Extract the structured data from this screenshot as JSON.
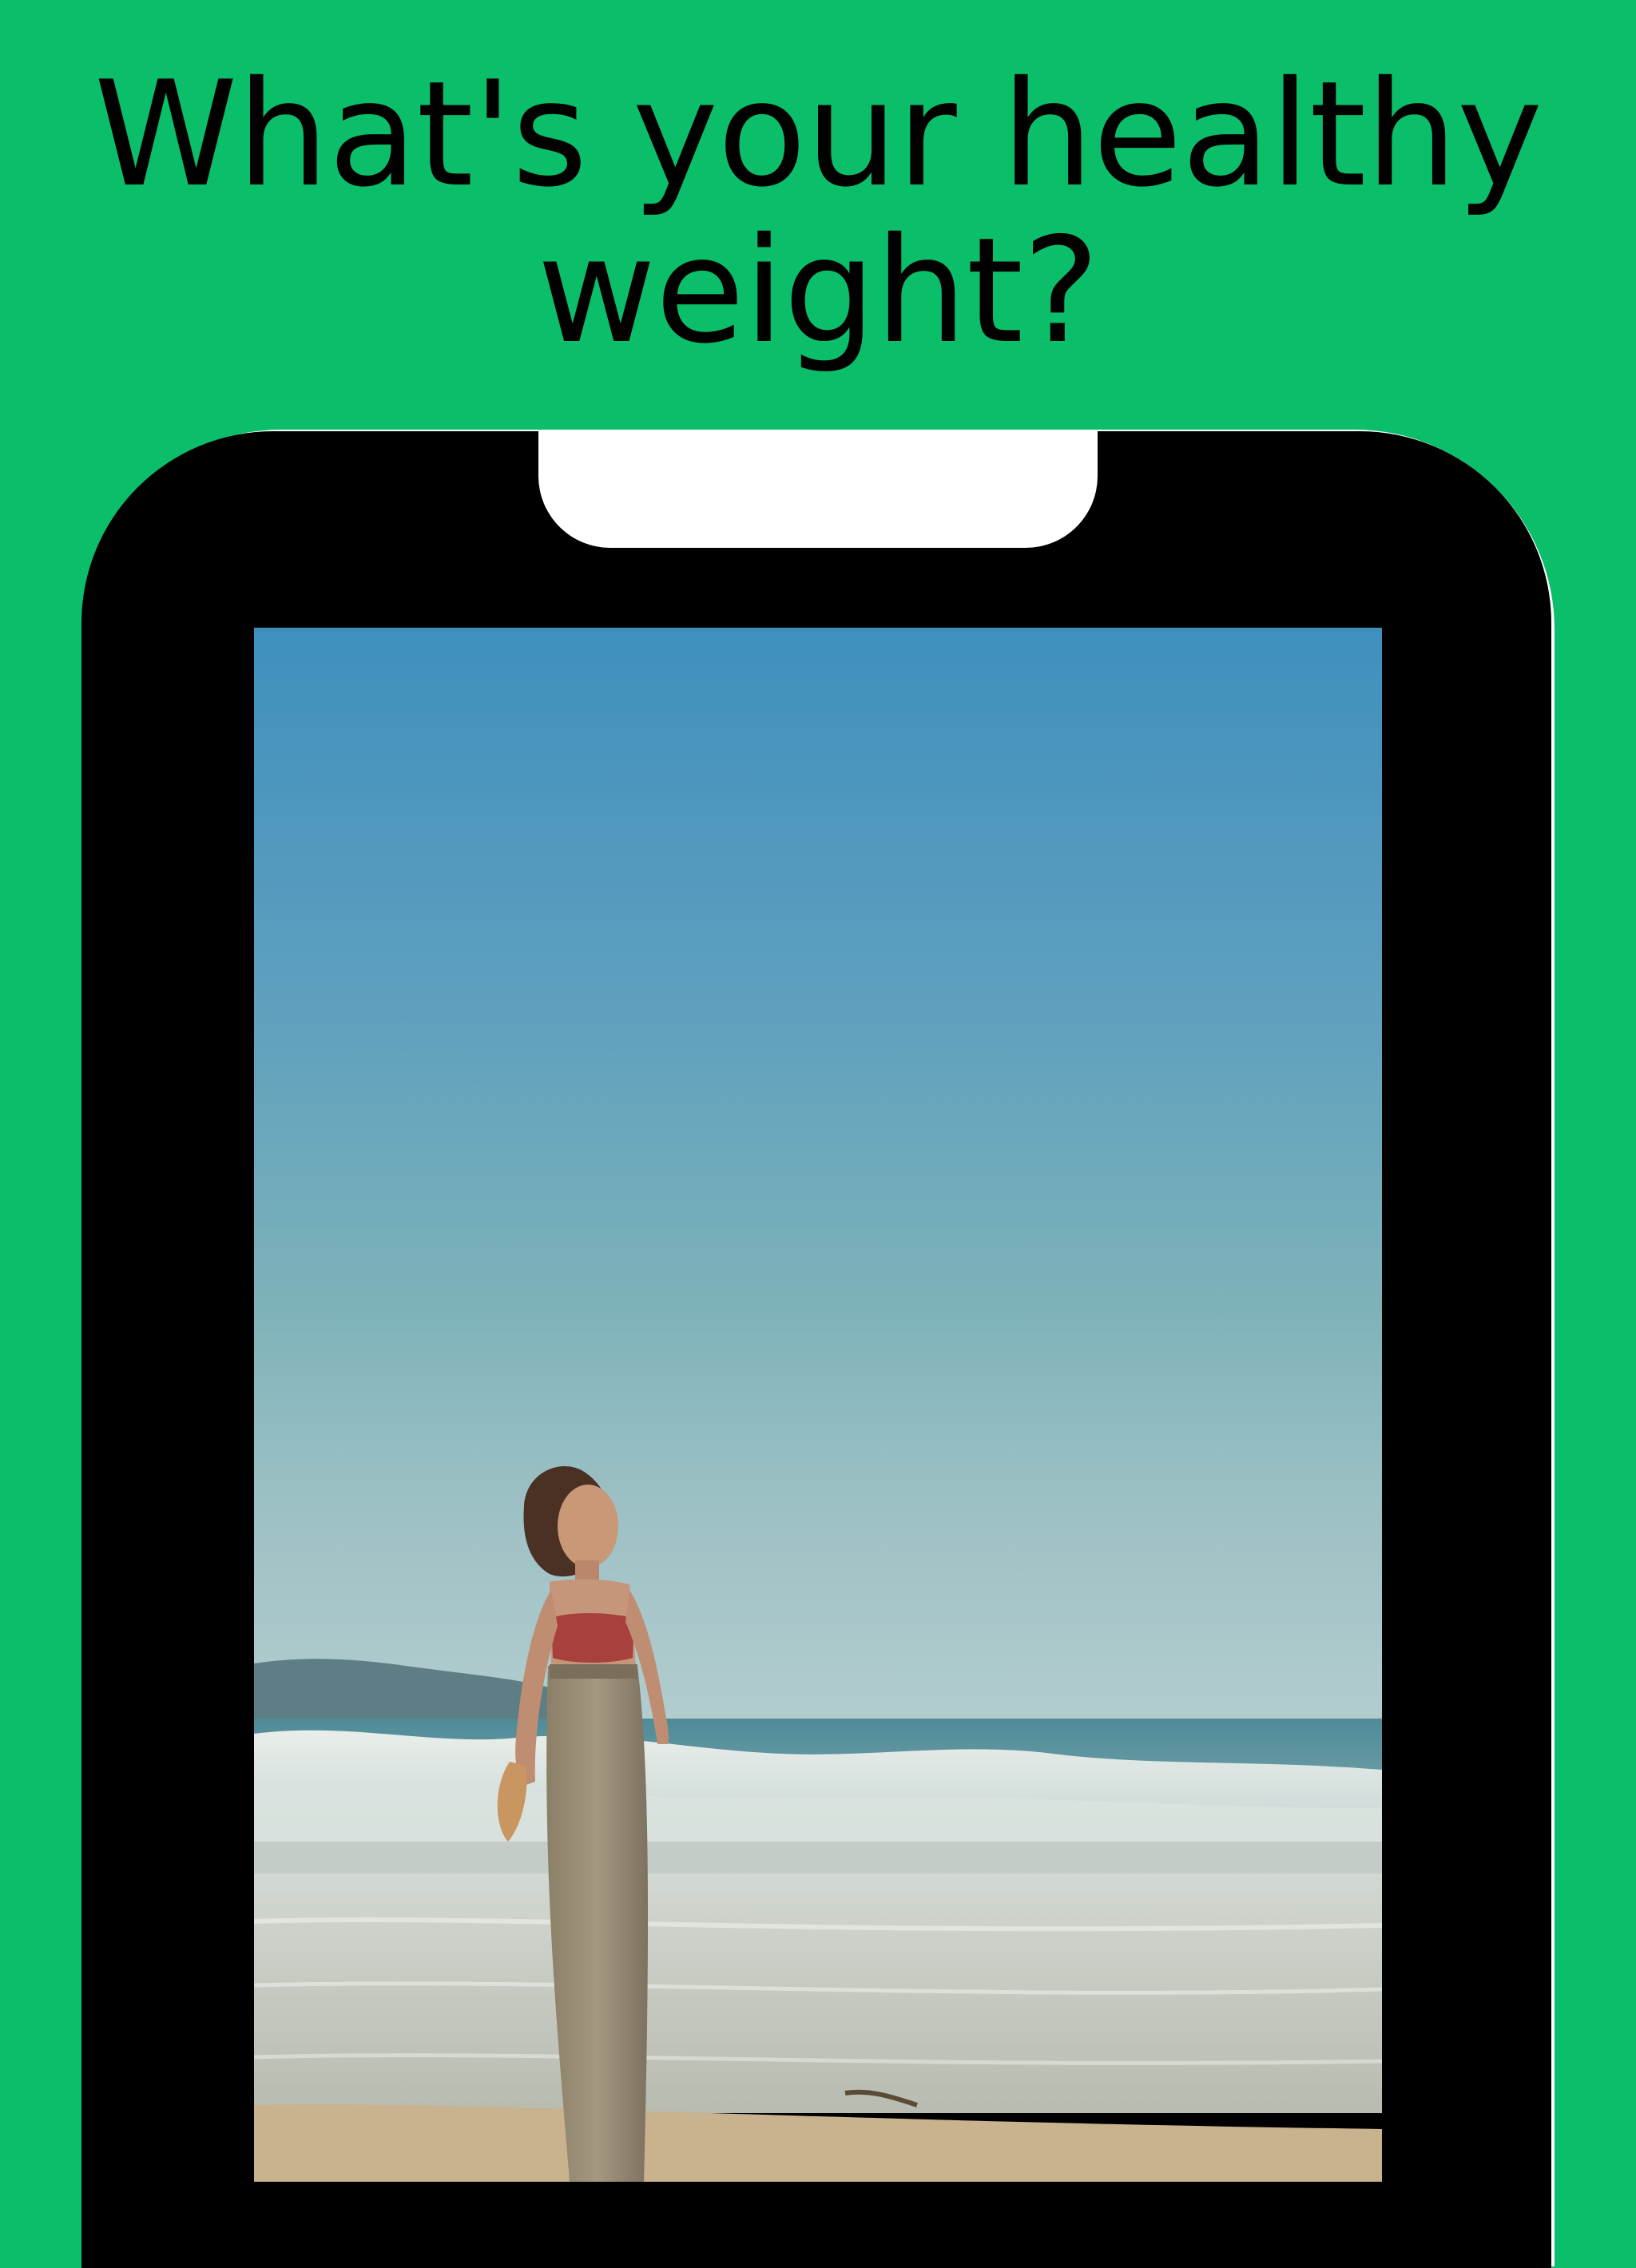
{
  "headline": {
    "text": "What's your healthy weight?"
  },
  "colors": {
    "background": "#0BBF6A",
    "device_frame": "#000000",
    "notch": "#FFFFFF",
    "headline_text": "#000000"
  },
  "device": {
    "screen_content": "beach-walk-photo"
  }
}
